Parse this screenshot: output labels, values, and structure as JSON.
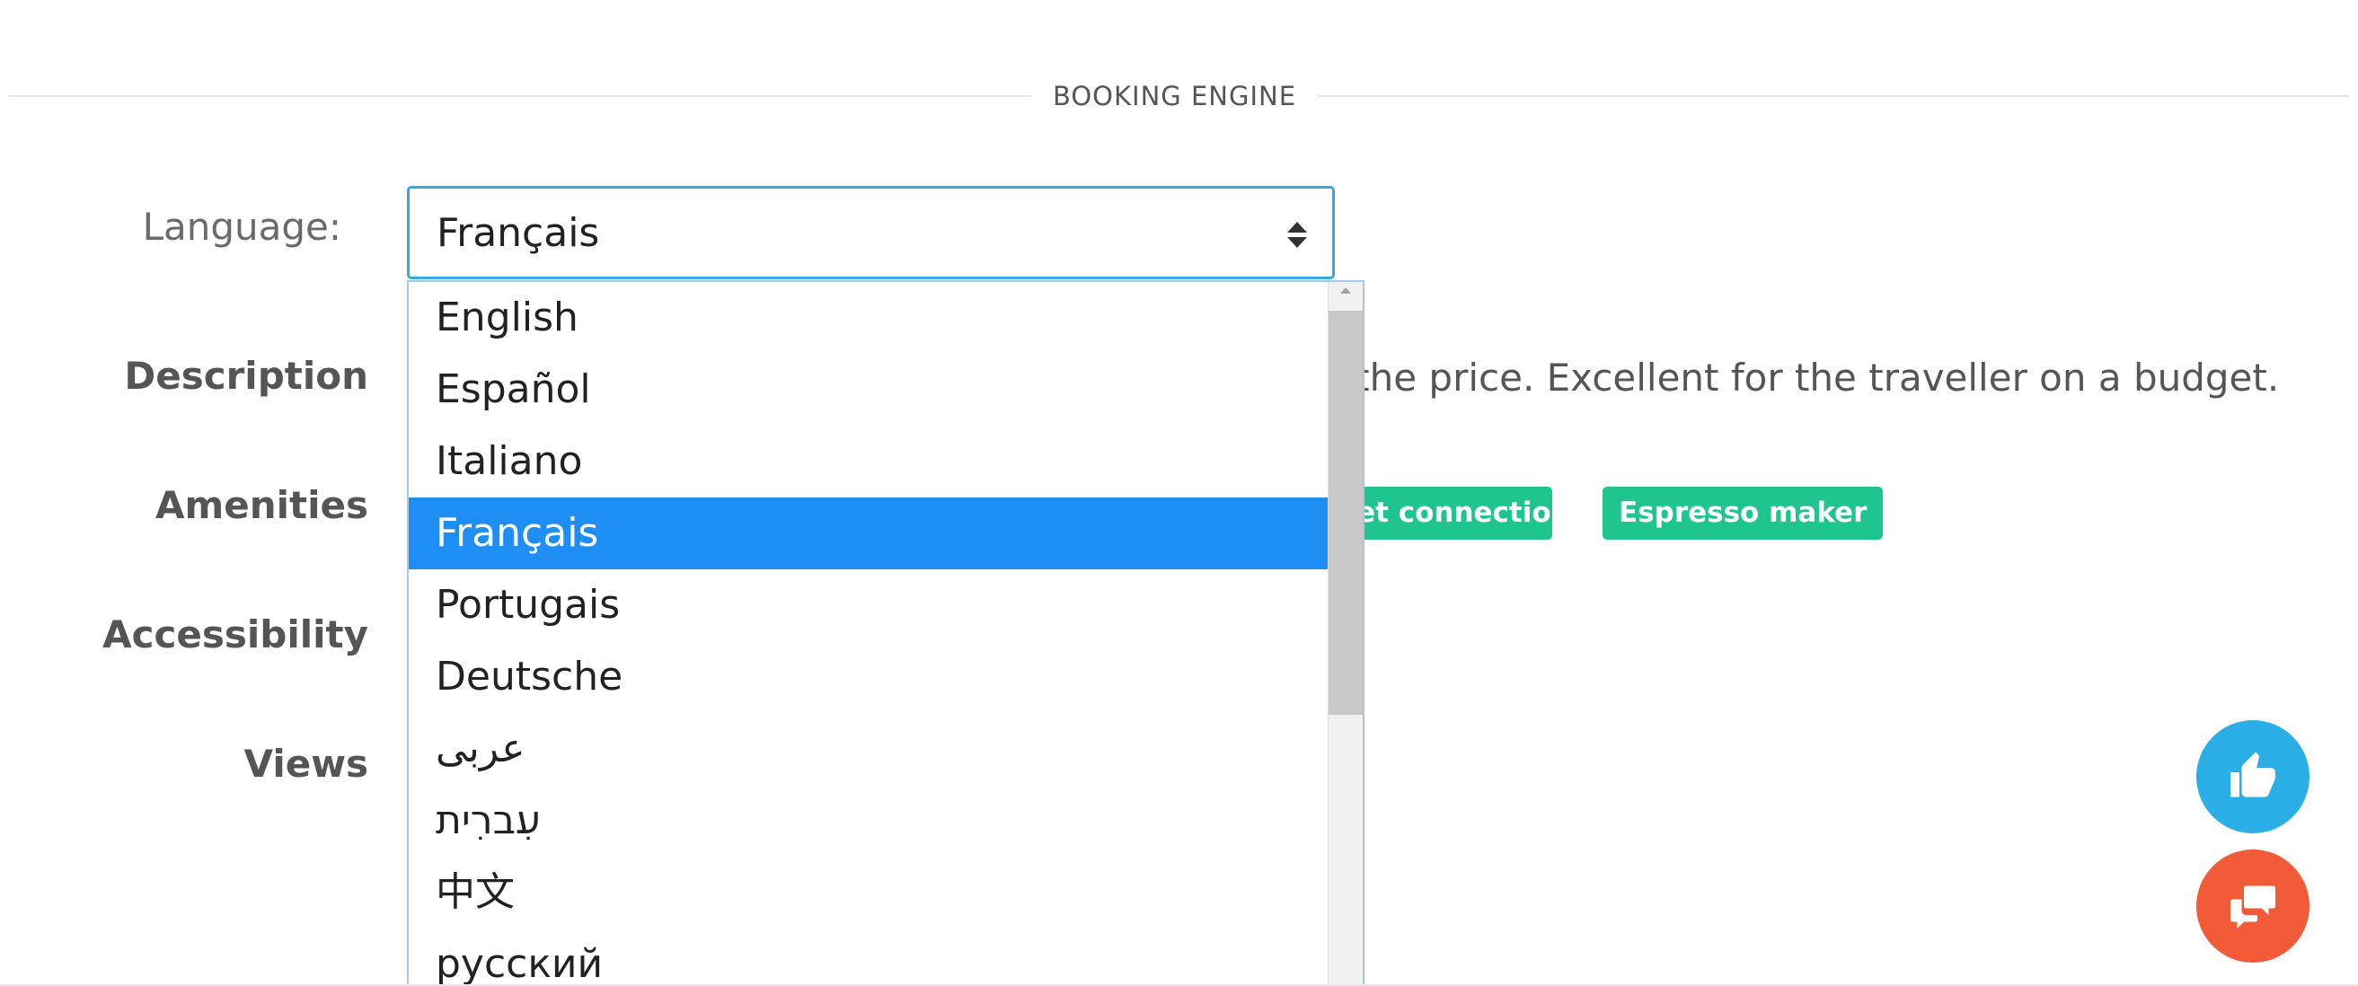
{
  "section": {
    "title": "BOOKING ENGINE"
  },
  "form": {
    "language_label": "Language:",
    "description_label": "Description",
    "amenities_label": "Amenities",
    "accessibility_label": "Accessibility",
    "views_label": "Views"
  },
  "language_select": {
    "value": "Français",
    "options": [
      "English",
      "Español",
      "Italiano",
      "Français",
      "Portugais",
      "Deutsche",
      "عربى",
      "עִברִית",
      "中文",
      "русский"
    ],
    "selected_index": 3
  },
  "description": {
    "visible_text": "f the price. Excellent for the traveller on a budget."
  },
  "amenities": {
    "tags": [
      "net connection",
      "Espresso maker"
    ]
  },
  "colors": {
    "accent_blue": "#1e8ef5",
    "select_border": "#35a8e0",
    "tag_green": "#1fc58f",
    "like_button": "#2aaee6",
    "chat_button": "#f25a38"
  },
  "icons": {
    "like": "thumbs-up-icon",
    "chat": "chat-bubbles-icon"
  }
}
